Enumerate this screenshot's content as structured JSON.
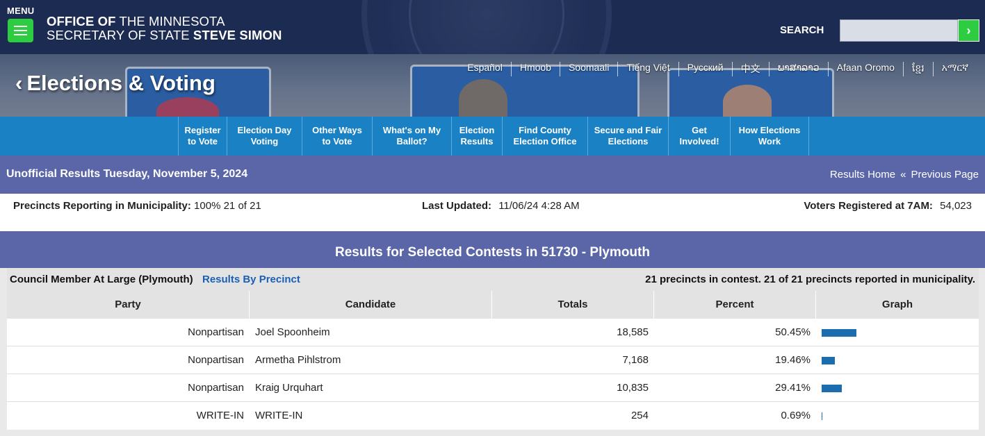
{
  "header": {
    "menu_label": "MENU",
    "office_line1_bold": "OFFICE OF",
    "office_line1_rest": " THE MINNESOTA",
    "office_line2_rest": "SECRETARY OF STATE ",
    "office_line2_bold": "STEVE SIMON",
    "search_label": "SEARCH",
    "search_value": "",
    "search_go": "›"
  },
  "hero": {
    "title": "Elections & Voting",
    "back_glyph": "‹",
    "languages": [
      "Español",
      "Hmoob",
      "Soomaali",
      "Tiếng Việt",
      "Русский",
      "中文",
      "ພາສາລາວ",
      "Afaan Oromo",
      "ខ្មែរ",
      "አማርኛ"
    ]
  },
  "nav": {
    "items": [
      {
        "label": "Register\nto Vote"
      },
      {
        "label": "Election Day\nVoting"
      },
      {
        "label": "Other Ways\nto Vote"
      },
      {
        "label": "What's on My\nBallot?"
      },
      {
        "label": "Election\nResults"
      },
      {
        "label": "Find County\nElection Office"
      },
      {
        "label": "Secure and Fair\nElections"
      },
      {
        "label": "Get\nInvolved!"
      },
      {
        "label": "How Elections\nWork"
      }
    ]
  },
  "results_header": {
    "title": "Unofficial Results Tuesday, November 5, 2024",
    "results_home": "Results Home",
    "separator": "«",
    "previous_page": "Previous Page"
  },
  "stats": {
    "precincts_label": "Precincts Reporting in Municipality:",
    "precincts_pct": "100%",
    "precincts_count": "21 of 21",
    "updated_label": "Last Updated:",
    "updated_value": "11/06/24 4:28 AM",
    "voters_label": "Voters Registered at 7AM:",
    "voters_value": "54,023"
  },
  "results_title": "Results for Selected Contests in 51730 - Plymouth",
  "contest": {
    "name": "Council Member At Large (Plymouth)",
    "link": "Results By Precinct",
    "info": "21 precincts in contest. 21 of 21 precincts reported in municipality.",
    "columns": [
      "Party",
      "Candidate",
      "Totals",
      "Percent",
      "Graph"
    ],
    "rows": [
      {
        "party": "Nonpartisan",
        "candidate": "Joel Spoonheim",
        "total": "18,585",
        "percent": "50.45%",
        "pct_value": 50.45
      },
      {
        "party": "Nonpartisan",
        "candidate": "Armetha Pihlstrom",
        "total": "7,168",
        "percent": "19.46%",
        "pct_value": 19.46
      },
      {
        "party": "Nonpartisan",
        "candidate": "Kraig Urquhart",
        "total": "10,835",
        "percent": "29.41%",
        "pct_value": 29.41
      },
      {
        "party": "WRITE-IN",
        "candidate": "WRITE-IN",
        "total": "254",
        "percent": "0.69%",
        "pct_value": 0.69
      }
    ]
  },
  "colors": {
    "header_bg": "#1c2b52",
    "accent_green": "#2ecc40",
    "nav_bg": "#1a82c4",
    "band_bg": "#5a66a8",
    "bar_color": "#1b6db0",
    "link_color": "#1a5fb4"
  }
}
